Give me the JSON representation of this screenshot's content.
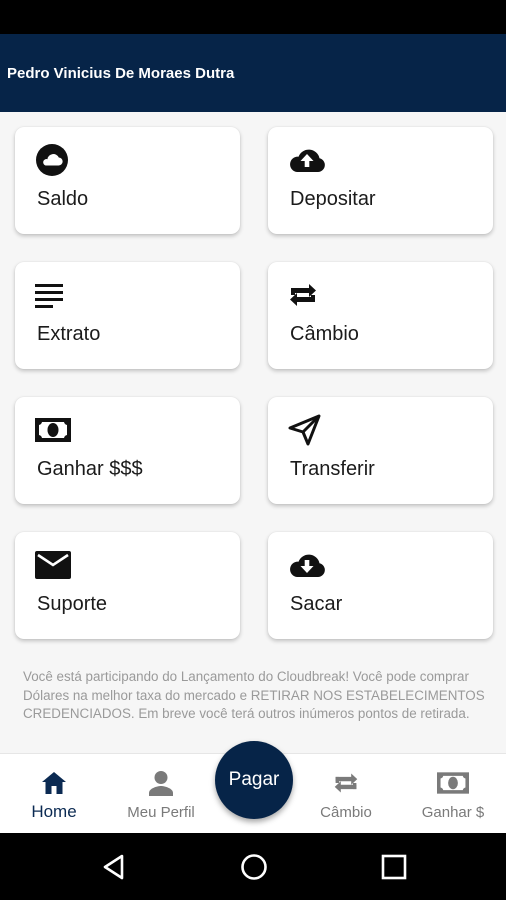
{
  "app_bar": {
    "title": "Pedro Vinicius De Moraes Dutra"
  },
  "colors": {
    "primary": "#062448",
    "icon": "#111111",
    "muted_text": "#9a9a9a"
  },
  "menu": [
    {
      "label": "Saldo",
      "icon": "cloud-icon"
    },
    {
      "label": "Depositar",
      "icon": "cloud-upload-icon"
    },
    {
      "label": "Extrato",
      "icon": "text-lines-icon"
    },
    {
      "label": "Câmbio",
      "icon": "swap-arrows-icon"
    },
    {
      "label": "Ganhar $$$",
      "icon": "money-bill-icon"
    },
    {
      "label": "Transferir",
      "icon": "send-icon"
    },
    {
      "label": "Suporte",
      "icon": "email-icon"
    },
    {
      "label": "Sacar",
      "icon": "cloud-download-icon"
    }
  ],
  "info_text": "Você está participando do Lançamento do Cloudbreak! Você pode comprar Dólares na melhor taxa do mercado e RETIRAR NOS ESTABELECIMENTOS CREDENCIADOS. Em breve você terá outros inúmeros pontos de retirada.",
  "bottom_nav": {
    "items": [
      {
        "label": "Home",
        "icon": "home-icon",
        "active": true
      },
      {
        "label": "Meu Perfil",
        "icon": "person-icon",
        "active": false
      },
      {
        "label": "Câmbio",
        "icon": "swap-arrows-icon",
        "active": false
      },
      {
        "label": "Ganhar $",
        "icon": "money-bill-icon",
        "active": false
      }
    ],
    "fab_label": "Pagar"
  },
  "system_nav": {
    "icons": [
      "back-icon",
      "home-circle-icon",
      "recents-icon"
    ]
  }
}
